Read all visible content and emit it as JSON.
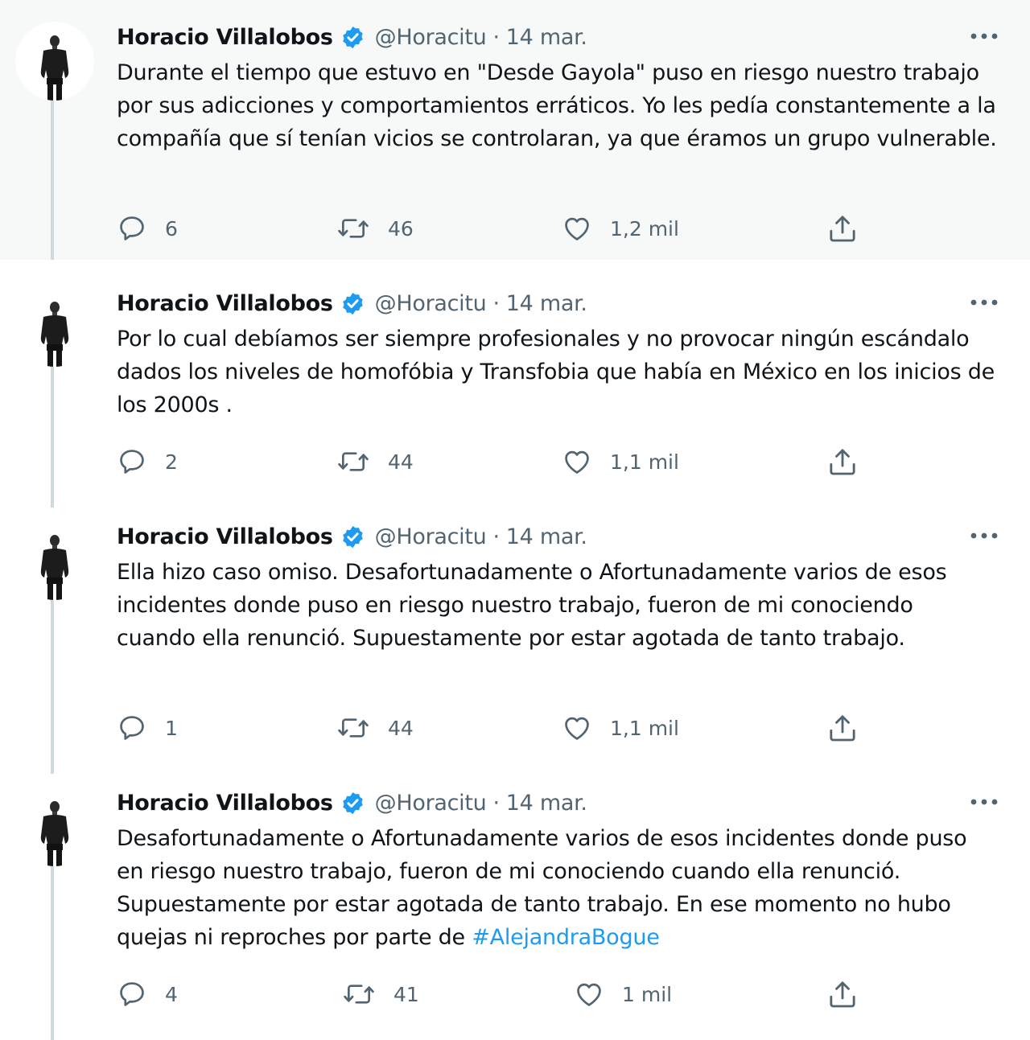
{
  "colors": {
    "accent": "#1d9bf0",
    "text_primary": "#0f1419",
    "text_secondary": "#536471",
    "thread_line": "#cfd9de",
    "highlight_background": "#f7f9f9"
  },
  "icons": {
    "verified": "verified-badge-icon",
    "more": "more-options-icon",
    "reply": "reply-icon",
    "retweet": "retweet-icon",
    "like": "like-heart-icon",
    "share": "share-icon"
  },
  "tweets": [
    {
      "author": {
        "name": "Horacio Villalobos",
        "handle": "@Horacitu",
        "verified": true
      },
      "separator": "·",
      "date": "14 mar.",
      "text": "Durante el tiempo que estuvo en \"Desde Gayola\" puso en riesgo nuestro trabajo por sus adicciones y comportamientos erráticos. Yo les pedía constantemente a la compañía que sí tenían vicios se controlaran, ya que éramos un grupo vulnerable.",
      "replies": "6",
      "retweets": "46",
      "likes": "1,2 mil"
    },
    {
      "author": {
        "name": "Horacio Villalobos",
        "handle": "@Horacitu",
        "verified": true
      },
      "separator": "·",
      "date": "14 mar.",
      "text": "Por lo cual  debíamos ser siempre profesionales y no provocar ningún escándalo dados los niveles de homofóbia  y Transfobia que había en México en los inicios de los 2000s .",
      "replies": "2",
      "retweets": "44",
      "likes": "1,1 mil"
    },
    {
      "author": {
        "name": "Horacio Villalobos",
        "handle": "@Horacitu",
        "verified": true
      },
      "separator": "·",
      "date": "14 mar.",
      "text": "Ella hizo caso omiso. Desafortunadamente o Afortunadamente  varios de esos incidentes donde puso en riesgo nuestro trabajo, fueron de mi conociendo cuando ella renunció. Supuestamente por estar agotada de tanto trabajo.",
      "replies": "1",
      "retweets": "44",
      "likes": "1,1 mil"
    },
    {
      "author": {
        "name": "Horacio Villalobos",
        "handle": "@Horacitu",
        "verified": true
      },
      "separator": "·",
      "date": "14 mar.",
      "text": "Desafortunadamente o Afortunadamente  varios de esos incidentes donde puso en riesgo nuestro trabajo, fueron de mi conociendo cuando ella renunció. Supuestamente por estar agotada de tanto trabajo. En ese momento no hubo quejas ni reproches por parte de ",
      "hashtag": "#AlejandraBogue",
      "replies": "4",
      "retweets": "41",
      "likes": "1 mil"
    }
  ]
}
